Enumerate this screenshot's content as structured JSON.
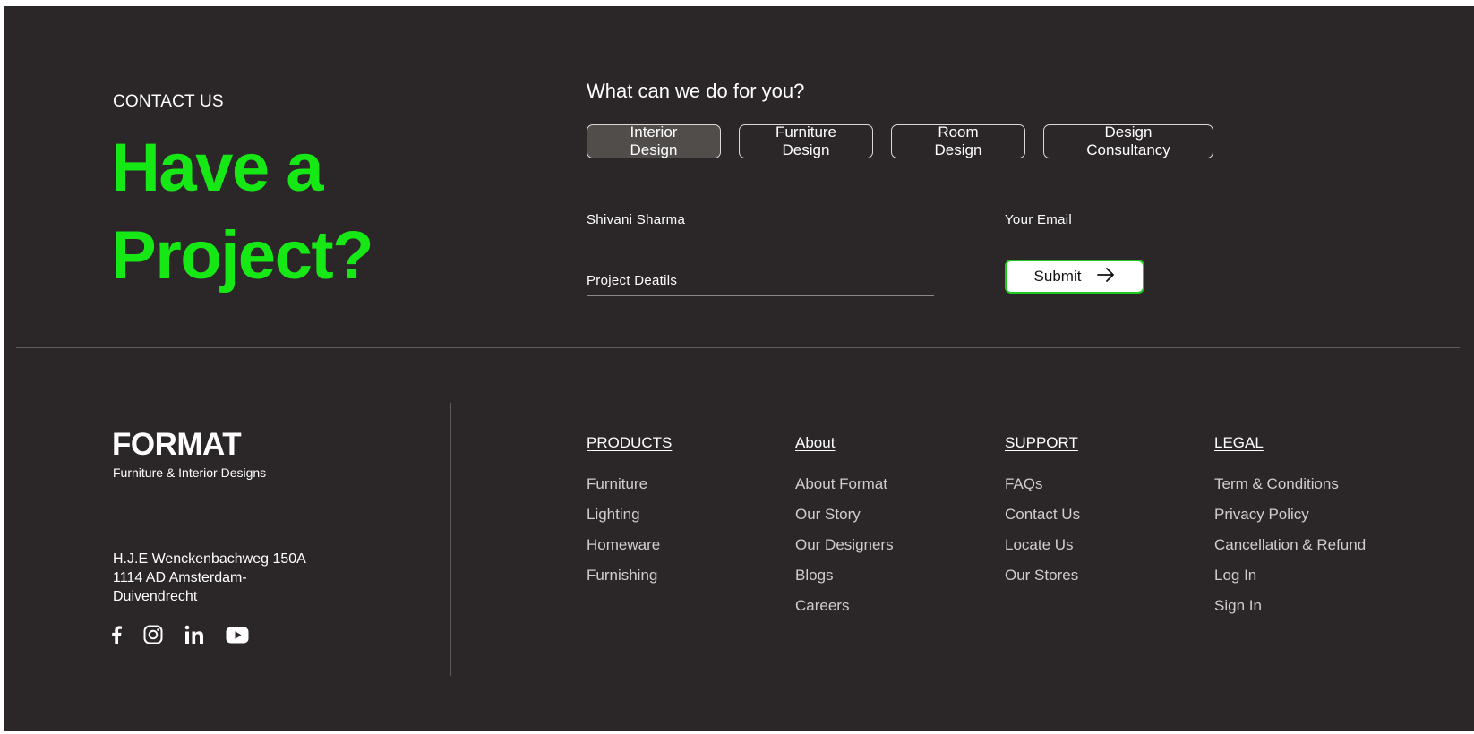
{
  "contact": {
    "eyebrow": "CONTACT US",
    "headline_line1": "Have a",
    "headline_line2": "Project?"
  },
  "form": {
    "question": "What can we do for you?",
    "services": [
      "Interior Design",
      "Furniture Design",
      "Room Design",
      "Design Consultancy"
    ],
    "active_service": "Interior Design",
    "name_value": "Shivani Sharma",
    "email_placeholder": "Your Email",
    "details_placeholder": "Project Deatils",
    "submit_label": "Submit"
  },
  "footer": {
    "brand": "FORMAT",
    "tagline": "Furniture & Interior Designs",
    "address": [
      "H.J.E Wenckenbachweg 150A",
      "1114 AD Amsterdam-",
      "Duivendrecht"
    ],
    "social_icons": [
      "facebook-icon",
      "instagram-icon",
      "linkedin-icon",
      "youtube-icon"
    ],
    "columns": [
      {
        "heading": "PRODUCTS",
        "links": [
          "Furniture",
          "Lighting",
          "Homeware",
          "Furnishing"
        ]
      },
      {
        "heading": "About",
        "links": [
          "About Format",
          "Our Story",
          "Our Designers",
          "Blogs",
          "Careers"
        ]
      },
      {
        "heading": "SUPPORT",
        "links": [
          "FAQs",
          "Contact Us",
          "Locate Us",
          "Our Stores"
        ]
      },
      {
        "heading": "LEGAL",
        "links": [
          "Term & Conditions",
          "Privacy Policy",
          "Cancellation & Refund",
          "Log In",
          "Sign In"
        ]
      }
    ]
  },
  "colors": {
    "background": "#2b2627",
    "accent_green": "#16e816",
    "active_button": "#504d4b"
  }
}
